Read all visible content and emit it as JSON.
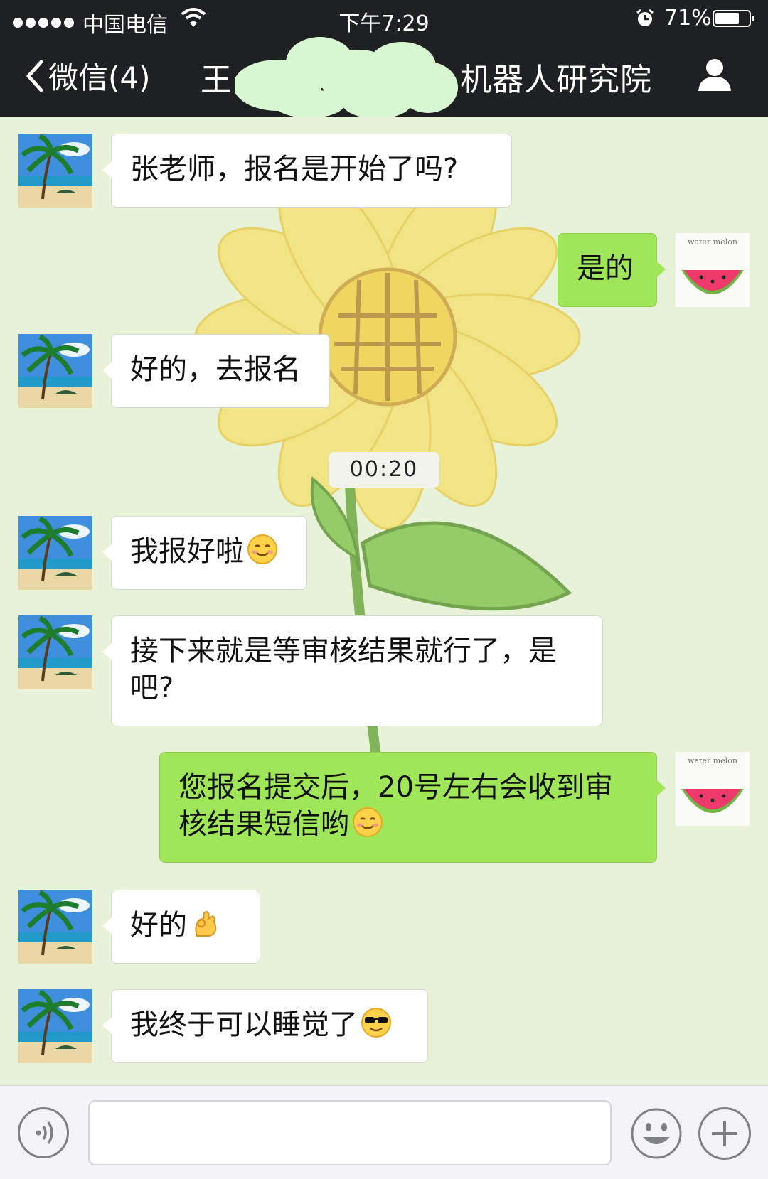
{
  "status_bar": {
    "carrier": "中国电信",
    "time": "下午7:29",
    "battery": "71%",
    "battery_level": 0.71
  },
  "nav": {
    "back_label": "微信(4)",
    "title_start": "王",
    "title_end": "机器人研究院"
  },
  "time_divider": "00:20",
  "messages": [
    {
      "side": "in",
      "text": "张老师，报名是开始了吗?"
    },
    {
      "side": "out",
      "text": "是的"
    },
    {
      "side": "in",
      "text": "好的，去报名"
    },
    {
      "side": "in",
      "text": "我报好啦",
      "emoji": "smile-emoji"
    },
    {
      "side": "in",
      "text": "接下来就是等审核结果就行了，是吧?"
    },
    {
      "side": "out",
      "text": "您报名提交后，20号左右会收到审核结果短信哟",
      "emoji": "smile-emoji"
    },
    {
      "side": "in",
      "text": "好的",
      "emoji": "ok-hand-emoji"
    },
    {
      "side": "in",
      "text": "我终于可以睡觉了",
      "emoji": "sunglasses-emoji"
    }
  ],
  "sticker_text": "water melon",
  "icons": {
    "back": "chevron-left-icon",
    "profile": "person-icon",
    "voice": "voice-icon",
    "emoji": "emoji-icon",
    "plus": "plus-icon",
    "wifi": "wifi-icon",
    "alarm": "alarm-icon"
  },
  "colors": {
    "bar_bg": "#1f2021",
    "chat_bg": "#e7f2d8",
    "outgoing_bubble": "#9fe658",
    "incoming_bubble": "#ffffff",
    "redaction": "#d7f7d3"
  }
}
